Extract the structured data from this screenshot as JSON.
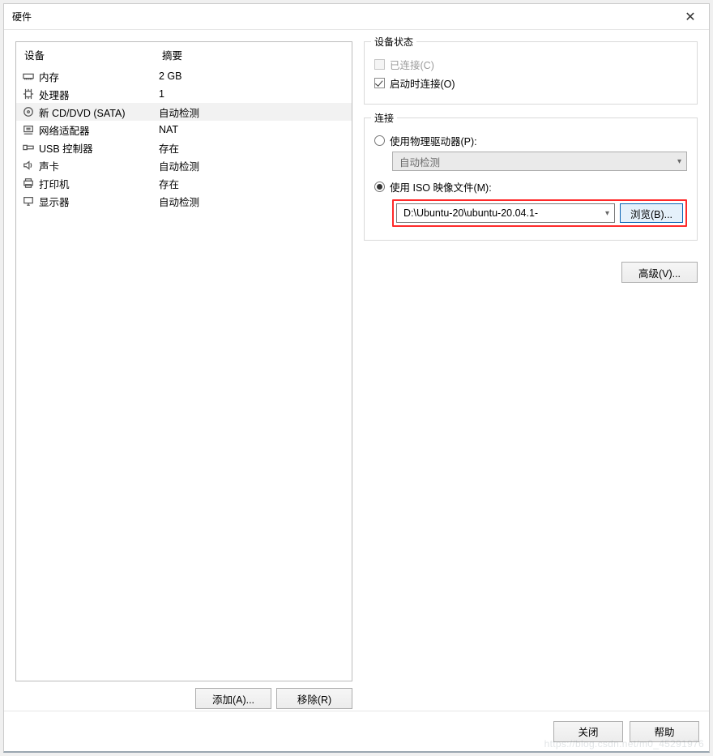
{
  "window": {
    "title": "硬件"
  },
  "hardware": {
    "header_device": "设备",
    "header_summary": "摘要",
    "selected_index": 2,
    "items": [
      {
        "icon": "memory-icon",
        "name": "内存",
        "summary": "2 GB"
      },
      {
        "icon": "cpu-icon",
        "name": "处理器",
        "summary": "1"
      },
      {
        "icon": "disc-icon",
        "name": "新 CD/DVD (SATA)",
        "summary": "自动检测"
      },
      {
        "icon": "network-icon",
        "name": "网络适配器",
        "summary": "NAT"
      },
      {
        "icon": "usb-icon",
        "name": "USB 控制器",
        "summary": "存在"
      },
      {
        "icon": "sound-icon",
        "name": "声卡",
        "summary": "自动检测"
      },
      {
        "icon": "printer-icon",
        "name": "打印机",
        "summary": "存在"
      },
      {
        "icon": "display-icon",
        "name": "显示器",
        "summary": "自动检测"
      }
    ],
    "add_label": "添加(A)...",
    "remove_label": "移除(R)"
  },
  "status": {
    "legend": "设备状态",
    "connected_label": "已连接(C)",
    "connected_checked": false,
    "connected_disabled": true,
    "connect_on_power_label": "启动时连接(O)",
    "connect_on_power_checked": true
  },
  "connection": {
    "legend": "连接",
    "physical_label": "使用物理驱动器(P):",
    "physical_selected": false,
    "physical_value": "自动检测",
    "iso_label": "使用 ISO 映像文件(M):",
    "iso_selected": true,
    "iso_value": "D:\\Ubuntu-20\\ubuntu-20.04.1-",
    "browse_label": "浏览(B)...",
    "advanced_label": "高级(V)..."
  },
  "footer": {
    "close_label": "关闭",
    "help_label": "帮助"
  },
  "watermark": "https://blog.csdn.net/m0_45291976"
}
